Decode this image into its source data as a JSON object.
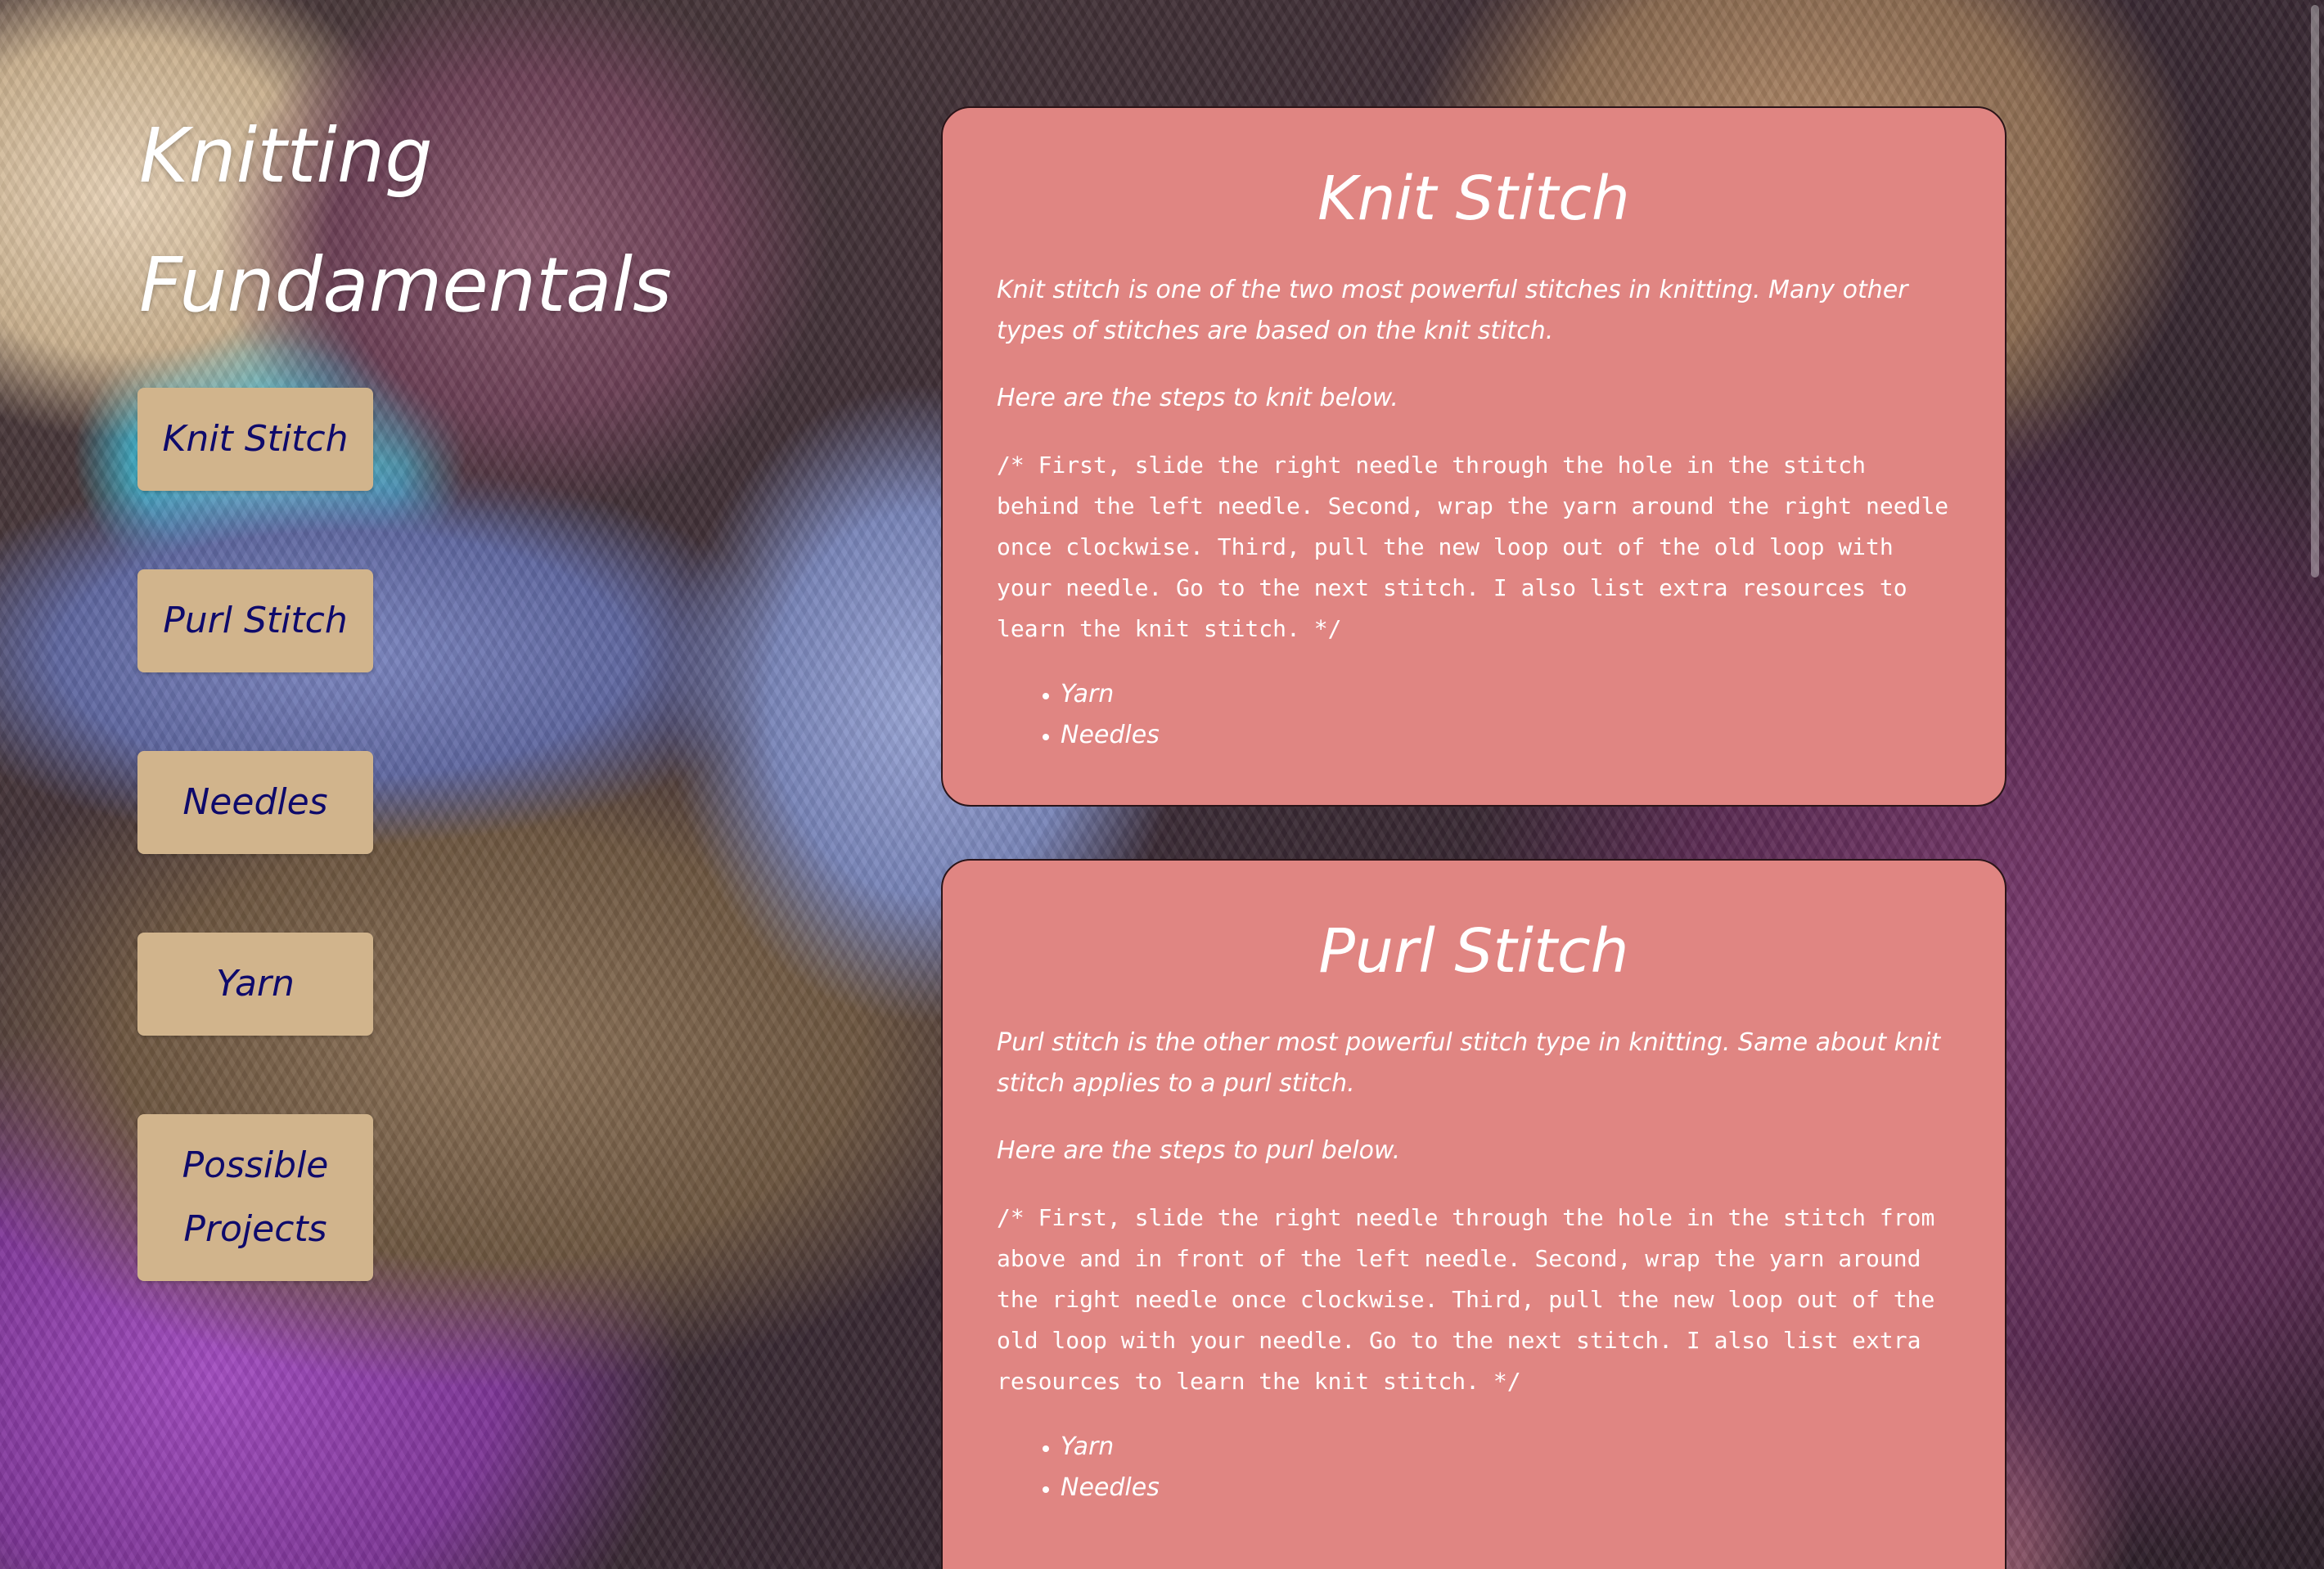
{
  "site": {
    "title_line1": "Knitting",
    "title_line2": "Fundamentals"
  },
  "nav": {
    "items": [
      {
        "label": "Knit Stitch"
      },
      {
        "label": "Purl Stitch"
      },
      {
        "label": "Needles"
      },
      {
        "label": "Yarn"
      },
      {
        "label_line1": "Possible",
        "label_line2": "Projects"
      }
    ]
  },
  "sections": {
    "knit": {
      "title": "Knit Stitch",
      "intro": "Knit stitch is one of the two most powerful stitches in knitting. Many other types of stitches are based on the knit stitch.",
      "steps_lead": "Here are the steps to knit below.",
      "steps": "/* First, slide the right needle through the hole in the stitch behind the left needle. Second, wrap the yarn around the right needle once clockwise. Third, pull the new loop out of the old loop with your needle. Go to the next stitch. I also list extra resources to learn the knit stitch. */",
      "resources": [
        "Yarn",
        "Needles"
      ]
    },
    "purl": {
      "title": "Purl Stitch",
      "intro": "Purl stitch is the other most powerful stitch type in knitting. Same about knit stitch applies to a purl stitch.",
      "steps_lead": "Here are the steps to purl below.",
      "steps": "/* First, slide the right needle through the hole in the stitch from above and in front of the left needle. Second, wrap the yarn around the right needle once clockwise. Third, pull the new loop out of the old loop with your needle. Go to the next stitch. I also list extra resources to learn the knit stitch. */",
      "resources": [
        "Yarn",
        "Needles"
      ]
    }
  },
  "colors": {
    "card_bg": "#e08582",
    "nav_bg": "#d1b48c",
    "nav_text": "#0e0a6b",
    "title_text": "#ffffff"
  }
}
